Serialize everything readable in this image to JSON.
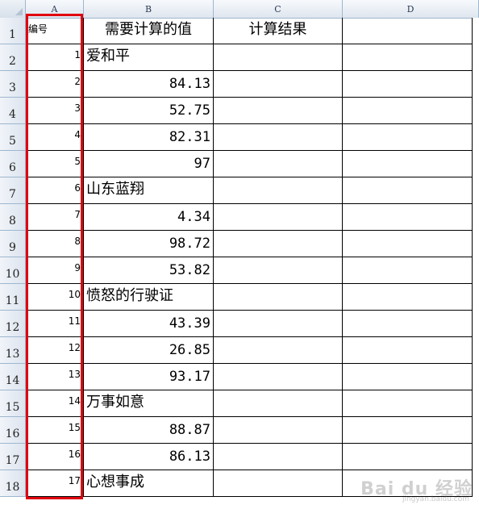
{
  "columns": [
    "A",
    "B",
    "C",
    "D"
  ],
  "headers": {
    "id": "编号",
    "value": "需要计算的值",
    "result": "计算结果"
  },
  "rows": [
    {
      "num": "1",
      "id": "",
      "b": "需要计算的值",
      "type": "hdr"
    },
    {
      "num": "2",
      "id": "1",
      "b": "爱和平",
      "type": "text"
    },
    {
      "num": "3",
      "id": "2",
      "b": "84.13",
      "type": "num"
    },
    {
      "num": "4",
      "id": "3",
      "b": "52.75",
      "type": "num"
    },
    {
      "num": "5",
      "id": "4",
      "b": "82.31",
      "type": "num"
    },
    {
      "num": "6",
      "id": "5",
      "b": "97",
      "type": "num"
    },
    {
      "num": "7",
      "id": "6",
      "b": "山东蓝翔",
      "type": "text"
    },
    {
      "num": "8",
      "id": "7",
      "b": "4.34",
      "type": "num"
    },
    {
      "num": "9",
      "id": "8",
      "b": "98.72",
      "type": "num"
    },
    {
      "num": "10",
      "id": "9",
      "b": "53.82",
      "type": "num"
    },
    {
      "num": "11",
      "id": "10",
      "b": "愤怒的行驶证",
      "type": "text"
    },
    {
      "num": "12",
      "id": "11",
      "b": "43.39",
      "type": "num"
    },
    {
      "num": "13",
      "id": "12",
      "b": "26.85",
      "type": "num"
    },
    {
      "num": "14",
      "id": "13",
      "b": "93.17",
      "type": "num"
    },
    {
      "num": "15",
      "id": "14",
      "b": "万事如意",
      "type": "text"
    },
    {
      "num": "16",
      "id": "15",
      "b": "88.87",
      "type": "num"
    },
    {
      "num": "17",
      "id": "16",
      "b": "86.13",
      "type": "num"
    },
    {
      "num": "18",
      "id": "17",
      "b": "心想事成",
      "type": "text"
    }
  ],
  "watermark": {
    "brand": "Bai du 经验",
    "sub": "jingyan.baidu.com"
  },
  "colors": {
    "highlight": "#e0000f",
    "grid": "#000000",
    "header_border": "#9eb6ce"
  }
}
